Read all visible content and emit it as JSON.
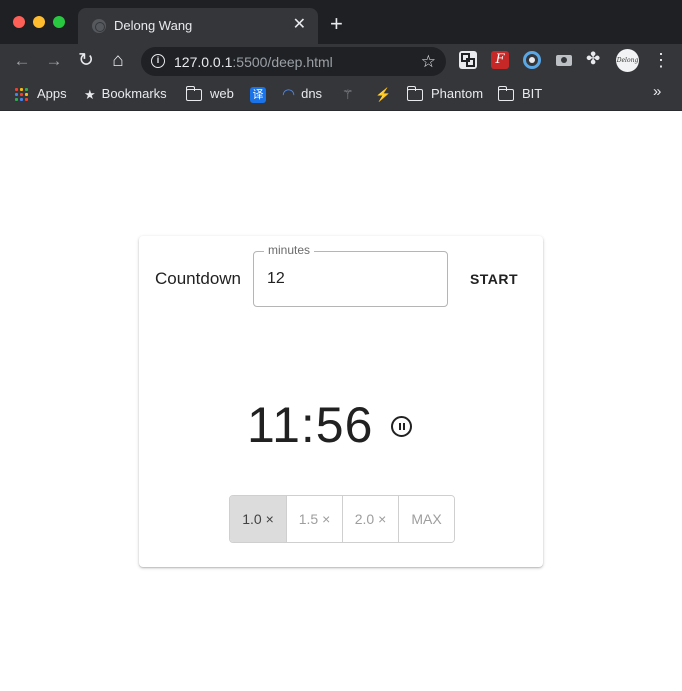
{
  "browser": {
    "tab_title": "Delong Wang",
    "tab_close": "✕",
    "new_tab": "+",
    "url_host": "127.0.0.1",
    "url_rest": ":5500/deep.html",
    "nav": {
      "back": "←",
      "forward": "→",
      "reload": "↻",
      "home": "⌂"
    },
    "bookmarks": [
      {
        "label": "Apps",
        "icon": "apps-grid-icon"
      },
      {
        "label": "Bookmarks",
        "icon": "star-icon"
      },
      {
        "label": "web",
        "icon": "folder-icon"
      },
      {
        "label": "",
        "icon": "translate-icon"
      },
      {
        "label": "dns",
        "icon": "cloud-icon"
      },
      {
        "label": "",
        "icon": "sprite-icon"
      },
      {
        "label": "",
        "icon": "arrow-logo-icon"
      },
      {
        "label": "Phantom",
        "icon": "folder-icon"
      },
      {
        "label": "BIT",
        "icon": "folder-icon"
      }
    ],
    "translate_glyph": "译",
    "more_bookmarks": "»",
    "colors": {
      "chrome_dark": "#1f2023",
      "toolbar": "#35363a",
      "omnibox": "#202124"
    }
  },
  "countdown": {
    "title": "Countdown",
    "minutes_label": "minutes",
    "minutes_value": "12",
    "start_label": "START",
    "time_display": "11:56",
    "speed_options": [
      "1.0 ×",
      "1.5 ×",
      "2.0 ×",
      "MAX"
    ],
    "selected_speed": "1.0 ×"
  }
}
